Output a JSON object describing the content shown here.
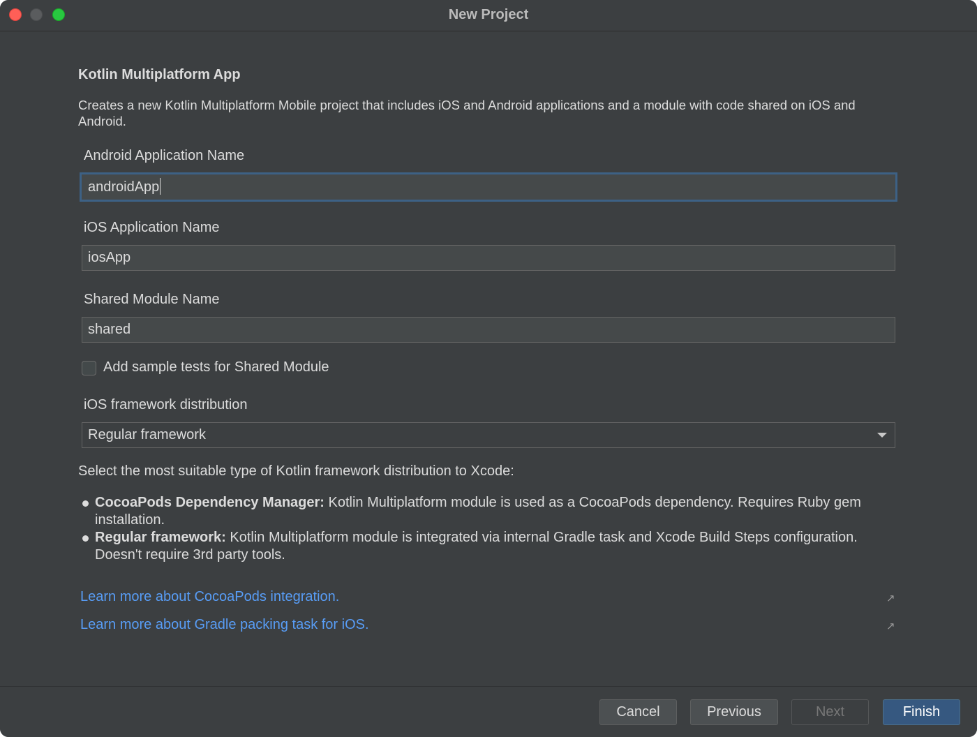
{
  "window": {
    "title": "New Project"
  },
  "wizard": {
    "heading": "Kotlin Multiplatform App",
    "description": "Creates a new Kotlin Multiplatform Mobile project that includes iOS and Android applications and a module with code shared on iOS and Android."
  },
  "fields": {
    "android_app_name": {
      "label": "Android Application Name",
      "value": "androidApp"
    },
    "ios_app_name": {
      "label": "iOS Application Name",
      "value": "iosApp"
    },
    "shared_module_name": {
      "label": "Shared Module Name",
      "value": "shared"
    },
    "sample_tests": {
      "label": "Add sample tests for Shared Module",
      "checked": false
    },
    "framework_distribution": {
      "label": "iOS framework distribution",
      "selected": "Regular framework"
    }
  },
  "help": {
    "intro": "Select the most suitable type of Kotlin framework distribution to Xcode:",
    "items": [
      {
        "title": "CocoaPods Dependency Manager:",
        "text": " Kotlin Multiplatform module is used as a CocoaPods dependency. Requires Ruby gem installation."
      },
      {
        "title": "Regular framework:",
        "text": " Kotlin Multiplatform module is integrated via internal Gradle task and Xcode Build Steps configuration. Doesn't require 3rd party tools."
      }
    ]
  },
  "links": [
    {
      "text": "Learn more about CocoaPods integration.",
      "icon": "external-link-icon"
    },
    {
      "text": "Learn more about Gradle packing task for iOS.",
      "icon": "external-link-icon"
    }
  ],
  "buttons": {
    "cancel": "Cancel",
    "previous": "Previous",
    "next": "Next",
    "finish": "Finish"
  },
  "colors": {
    "background": "#3c3f41",
    "link": "#589df6",
    "focus_border": "#3d6185",
    "primary_button": "#365880"
  }
}
